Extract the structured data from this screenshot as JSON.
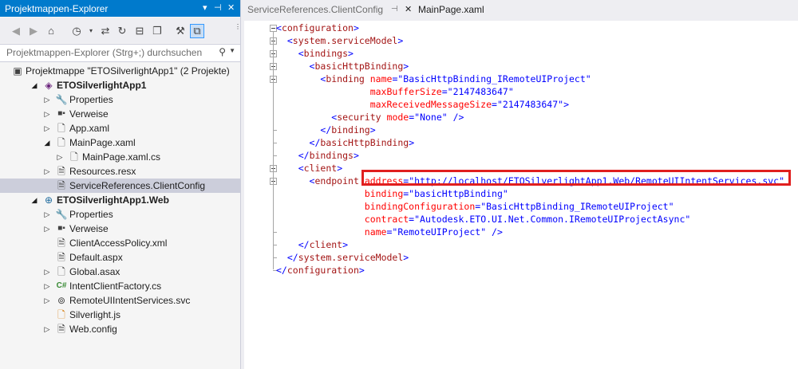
{
  "solution_explorer": {
    "title": "Projektmappen-Explorer",
    "title_controls": [
      "▾",
      "⊣",
      "✕"
    ],
    "search_placeholder": "Projektmappen-Explorer (Strg+;) durchsuchen",
    "toolbar_icons": [
      "back-icon",
      "forward-icon",
      "home-icon",
      "history-icon",
      "sync-icon",
      "refresh-icon",
      "collapse-all-icon",
      "show-all-files-icon",
      "properties-icon",
      "preview-icon"
    ],
    "tree": [
      {
        "label": "Projektmappe \"ETOSilverlightApp1\" (2 Projekte)",
        "depth": 0,
        "icon": "solution-icon",
        "expand": ""
      },
      {
        "label": "ETOSilverlightApp1",
        "depth": 1,
        "icon": "silverlight-project-icon",
        "expand": "◢",
        "bold": true
      },
      {
        "label": "Properties",
        "depth": 2,
        "icon": "wrench-icon",
        "expand": "▷"
      },
      {
        "label": "Verweise",
        "depth": 2,
        "icon": "references-icon",
        "expand": "▷"
      },
      {
        "label": "App.xaml",
        "depth": 2,
        "icon": "xaml-file-icon",
        "expand": "▷"
      },
      {
        "label": "MainPage.xaml",
        "depth": 2,
        "icon": "xaml-file-icon",
        "expand": "◢"
      },
      {
        "label": "MainPage.xaml.cs",
        "depth": 3,
        "icon": "cs-file-icon",
        "expand": "▷"
      },
      {
        "label": "Resources.resx",
        "depth": 2,
        "icon": "resx-file-icon",
        "expand": "▷"
      },
      {
        "label": "ServiceReferences.ClientConfig",
        "depth": 2,
        "icon": "config-file-icon",
        "expand": "",
        "selected": true
      },
      {
        "label": "ETOSilverlightApp1.Web",
        "depth": 1,
        "icon": "web-project-icon",
        "expand": "◢",
        "bold": true
      },
      {
        "label": "Properties",
        "depth": 2,
        "icon": "wrench-icon",
        "expand": "▷"
      },
      {
        "label": "Verweise",
        "depth": 2,
        "icon": "references-icon",
        "expand": "▷"
      },
      {
        "label": "ClientAccessPolicy.xml",
        "depth": 2,
        "icon": "xml-file-icon",
        "expand": ""
      },
      {
        "label": "Default.aspx",
        "depth": 2,
        "icon": "aspx-file-icon",
        "expand": ""
      },
      {
        "label": "Global.asax",
        "depth": 2,
        "icon": "asax-file-icon",
        "expand": "▷"
      },
      {
        "label": "IntentClientFactory.cs",
        "depth": 2,
        "icon": "csharp-icon",
        "expand": "▷"
      },
      {
        "label": "RemoteUIIntentServices.svc",
        "depth": 2,
        "icon": "svc-file-icon",
        "expand": "▷"
      },
      {
        "label": "Silverlight.js",
        "depth": 2,
        "icon": "js-file-icon",
        "expand": ""
      },
      {
        "label": "Web.config",
        "depth": 2,
        "icon": "config-file-icon",
        "expand": "▷"
      }
    ]
  },
  "tabs": [
    {
      "label": "ServiceReferences.ClientConfig",
      "active": true,
      "pin": "⊣",
      "close": "✕"
    },
    {
      "label": "MainPage.xaml",
      "active": false
    }
  ],
  "code_lines": [
    [
      [
        "br",
        "<"
      ],
      [
        "tg",
        "configuration"
      ],
      [
        "br",
        ">"
      ]
    ],
    [
      [
        "sp",
        "  "
      ],
      [
        "br",
        "<"
      ],
      [
        "tg",
        "system.serviceModel"
      ],
      [
        "br",
        ">"
      ]
    ],
    [
      [
        "sp",
        "    "
      ],
      [
        "br",
        "<"
      ],
      [
        "tg",
        "bindings"
      ],
      [
        "br",
        ">"
      ]
    ],
    [
      [
        "sp",
        "      "
      ],
      [
        "br",
        "<"
      ],
      [
        "tg",
        "basicHttpBinding"
      ],
      [
        "br",
        ">"
      ]
    ],
    [
      [
        "sp",
        "        "
      ],
      [
        "br",
        "<"
      ],
      [
        "tg",
        "binding"
      ],
      [
        "sp",
        " "
      ],
      [
        "at",
        "name"
      ],
      [
        "br",
        "=\""
      ],
      [
        "vl",
        "BasicHttpBinding_IRemoteUIProject"
      ],
      [
        "br",
        "\""
      ]
    ],
    [
      [
        "sp",
        "                 "
      ],
      [
        "at",
        "maxBufferSize"
      ],
      [
        "br",
        "=\""
      ],
      [
        "vl",
        "2147483647"
      ],
      [
        "br",
        "\""
      ]
    ],
    [
      [
        "sp",
        "                 "
      ],
      [
        "at",
        "maxReceivedMessageSize"
      ],
      [
        "br",
        "=\""
      ],
      [
        "vl",
        "2147483647"
      ],
      [
        "br",
        "\">"
      ]
    ],
    [
      [
        "sp",
        "          "
      ],
      [
        "br",
        "<"
      ],
      [
        "tg",
        "security"
      ],
      [
        "sp",
        " "
      ],
      [
        "at",
        "mode"
      ],
      [
        "br",
        "=\""
      ],
      [
        "vl",
        "None"
      ],
      [
        "br",
        "\" />"
      ]
    ],
    [
      [
        "sp",
        "        "
      ],
      [
        "br",
        "</"
      ],
      [
        "tg",
        "binding"
      ],
      [
        "br",
        ">"
      ]
    ],
    [
      [
        "sp",
        "      "
      ],
      [
        "br",
        "</"
      ],
      [
        "tg",
        "basicHttpBinding"
      ],
      [
        "br",
        ">"
      ]
    ],
    [
      [
        "sp",
        "    "
      ],
      [
        "br",
        "</"
      ],
      [
        "tg",
        "bindings"
      ],
      [
        "br",
        ">"
      ]
    ],
    [
      [
        "sp",
        "    "
      ],
      [
        "br",
        "<"
      ],
      [
        "tg",
        "client"
      ],
      [
        "br",
        ">"
      ]
    ],
    [
      [
        "sp",
        "      "
      ],
      [
        "br",
        "<"
      ],
      [
        "tg",
        "endpoint"
      ],
      [
        "sp",
        " "
      ],
      [
        "at",
        "address"
      ],
      [
        "br",
        "=\""
      ],
      [
        "lnk",
        "http://localhost/ETOSilverlightApp1.Web/RemoteUIIntentServices.svc"
      ],
      [
        "br",
        "\""
      ]
    ],
    [
      [
        "sp",
        "                "
      ],
      [
        "at",
        "binding"
      ],
      [
        "br",
        "=\""
      ],
      [
        "vl",
        "basicHttpBinding"
      ],
      [
        "br",
        "\""
      ]
    ],
    [
      [
        "sp",
        "                "
      ],
      [
        "at",
        "bindingConfiguration"
      ],
      [
        "br",
        "=\""
      ],
      [
        "vl",
        "BasicHttpBinding_IRemoteUIProject"
      ],
      [
        "br",
        "\""
      ]
    ],
    [
      [
        "sp",
        "                "
      ],
      [
        "at",
        "contract"
      ],
      [
        "br",
        "=\""
      ],
      [
        "vl",
        "Autodesk.ETO.UI.Net.Common.IRemoteUIProjectAsync"
      ],
      [
        "br",
        "\""
      ]
    ],
    [
      [
        "sp",
        "                "
      ],
      [
        "at",
        "name"
      ],
      [
        "br",
        "=\""
      ],
      [
        "vl",
        "RemoteUIProject"
      ],
      [
        "br",
        "\" />"
      ]
    ],
    [
      [
        "sp",
        "    "
      ],
      [
        "br",
        "</"
      ],
      [
        "tg",
        "client"
      ],
      [
        "br",
        ">"
      ]
    ],
    [
      [
        "sp",
        "  "
      ],
      [
        "br",
        "</"
      ],
      [
        "tg",
        "system.serviceModel"
      ],
      [
        "br",
        ">"
      ]
    ],
    [
      [
        "br",
        "</"
      ],
      [
        "tg",
        "configuration"
      ],
      [
        "br",
        ">"
      ]
    ]
  ]
}
